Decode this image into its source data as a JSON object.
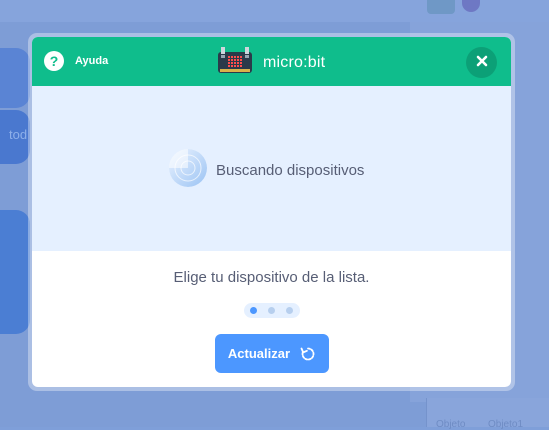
{
  "background": {
    "block_text": "tod",
    "tabs": [
      "Objeto",
      "Objeto1"
    ]
  },
  "modal": {
    "help_label": "Ayuda",
    "help_icon": "question-icon",
    "title": "micro:bit",
    "device_icon": "microbit-board-icon",
    "close_icon": "close-icon",
    "searching_label": "Buscando dispositivos",
    "instruction": "Elige tu dispositivo de la lista.",
    "refresh_label": "Actualizar",
    "refresh_icon": "refresh-icon",
    "progress_step": 1,
    "progress_total": 3
  },
  "colors": {
    "header": "#0fbd8c",
    "search_area": "#e5f0ff",
    "button": "#4c97ff",
    "text": "#575e75"
  }
}
